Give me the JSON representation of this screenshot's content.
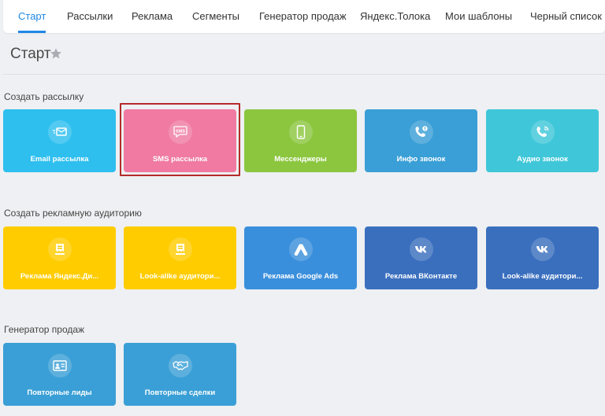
{
  "nav": {
    "tabs": [
      {
        "label": "Старт",
        "active": true
      },
      {
        "label": "Рассылки"
      },
      {
        "label": "Реклама"
      },
      {
        "label": "Сегменты"
      },
      {
        "label": "Генератор продаж"
      },
      {
        "label": "Яндекс.Толока"
      },
      {
        "label": "Мои шаблоны"
      },
      {
        "label": "Черный список"
      }
    ]
  },
  "page": {
    "title": "Старт"
  },
  "sections": {
    "mailing": {
      "title": "Создать рассылку",
      "tiles": [
        {
          "label": "Email рассылка",
          "icon": "email-icon",
          "color": "#2ebfef"
        },
        {
          "label": "SMS рассылка",
          "icon": "sms-icon",
          "color": "#f07aa1",
          "highlighted": true
        },
        {
          "label": "Мессенджеры",
          "icon": "smartphone-icon",
          "color": "#8cc63f"
        },
        {
          "label": "Инфо звонок",
          "icon": "phone-info-icon",
          "color": "#3a9fd6"
        },
        {
          "label": "Аудио звонок",
          "icon": "phone-audio-icon",
          "color": "#3fc7d9"
        }
      ]
    },
    "audience": {
      "title": "Создать рекламную аудиторию",
      "tiles": [
        {
          "label": "Реклама Яндекс.Ди...",
          "icon": "yandex-direct-icon",
          "color": "#ffcc00"
        },
        {
          "label": "Look-alike аудитори...",
          "icon": "yandex-lookalike-icon",
          "color": "#ffcc00"
        },
        {
          "label": "Реклама Google Ads",
          "icon": "google-ads-icon",
          "color": "#3a8fdc"
        },
        {
          "label": "Реклама ВКонтакте",
          "icon": "vk-icon",
          "color": "#3a6fbe"
        },
        {
          "label": "Look-alike аудитори...",
          "icon": "vk-lookalike-icon",
          "color": "#3a6fbe"
        }
      ]
    },
    "sales": {
      "title": "Генератор продаж",
      "tiles": [
        {
          "label": "Повторные лиды",
          "icon": "leads-icon",
          "color": "#3a9fd6"
        },
        {
          "label": "Повторные сделки",
          "icon": "handshake-icon",
          "color": "#3a9fd6"
        }
      ]
    }
  }
}
